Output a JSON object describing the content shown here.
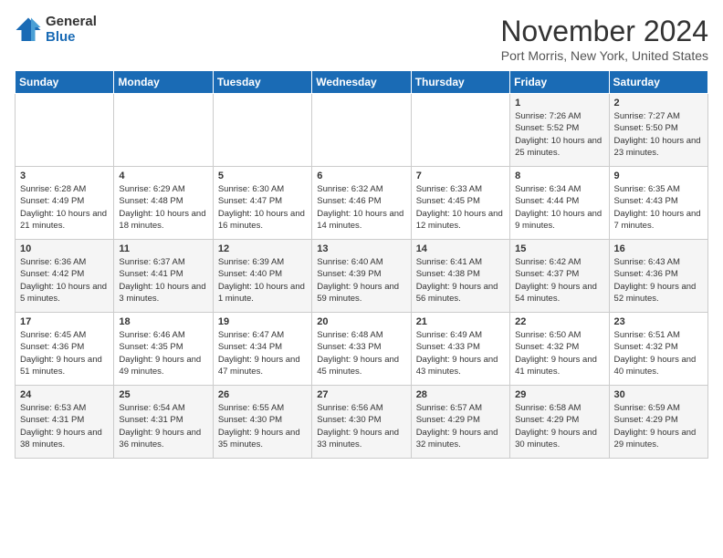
{
  "logo": {
    "general": "General",
    "blue": "Blue"
  },
  "title": "November 2024",
  "location": "Port Morris, New York, United States",
  "headers": [
    "Sunday",
    "Monday",
    "Tuesday",
    "Wednesday",
    "Thursday",
    "Friday",
    "Saturday"
  ],
  "weeks": [
    [
      {
        "day": "",
        "info": ""
      },
      {
        "day": "",
        "info": ""
      },
      {
        "day": "",
        "info": ""
      },
      {
        "day": "",
        "info": ""
      },
      {
        "day": "",
        "info": ""
      },
      {
        "day": "1",
        "info": "Sunrise: 7:26 AM\nSunset: 5:52 PM\nDaylight: 10 hours and 25 minutes."
      },
      {
        "day": "2",
        "info": "Sunrise: 7:27 AM\nSunset: 5:50 PM\nDaylight: 10 hours and 23 minutes."
      }
    ],
    [
      {
        "day": "3",
        "info": "Sunrise: 6:28 AM\nSunset: 4:49 PM\nDaylight: 10 hours and 21 minutes."
      },
      {
        "day": "4",
        "info": "Sunrise: 6:29 AM\nSunset: 4:48 PM\nDaylight: 10 hours and 18 minutes."
      },
      {
        "day": "5",
        "info": "Sunrise: 6:30 AM\nSunset: 4:47 PM\nDaylight: 10 hours and 16 minutes."
      },
      {
        "day": "6",
        "info": "Sunrise: 6:32 AM\nSunset: 4:46 PM\nDaylight: 10 hours and 14 minutes."
      },
      {
        "day": "7",
        "info": "Sunrise: 6:33 AM\nSunset: 4:45 PM\nDaylight: 10 hours and 12 minutes."
      },
      {
        "day": "8",
        "info": "Sunrise: 6:34 AM\nSunset: 4:44 PM\nDaylight: 10 hours and 9 minutes."
      },
      {
        "day": "9",
        "info": "Sunrise: 6:35 AM\nSunset: 4:43 PM\nDaylight: 10 hours and 7 minutes."
      }
    ],
    [
      {
        "day": "10",
        "info": "Sunrise: 6:36 AM\nSunset: 4:42 PM\nDaylight: 10 hours and 5 minutes."
      },
      {
        "day": "11",
        "info": "Sunrise: 6:37 AM\nSunset: 4:41 PM\nDaylight: 10 hours and 3 minutes."
      },
      {
        "day": "12",
        "info": "Sunrise: 6:39 AM\nSunset: 4:40 PM\nDaylight: 10 hours and 1 minute."
      },
      {
        "day": "13",
        "info": "Sunrise: 6:40 AM\nSunset: 4:39 PM\nDaylight: 9 hours and 59 minutes."
      },
      {
        "day": "14",
        "info": "Sunrise: 6:41 AM\nSunset: 4:38 PM\nDaylight: 9 hours and 56 minutes."
      },
      {
        "day": "15",
        "info": "Sunrise: 6:42 AM\nSunset: 4:37 PM\nDaylight: 9 hours and 54 minutes."
      },
      {
        "day": "16",
        "info": "Sunrise: 6:43 AM\nSunset: 4:36 PM\nDaylight: 9 hours and 52 minutes."
      }
    ],
    [
      {
        "day": "17",
        "info": "Sunrise: 6:45 AM\nSunset: 4:36 PM\nDaylight: 9 hours and 51 minutes."
      },
      {
        "day": "18",
        "info": "Sunrise: 6:46 AM\nSunset: 4:35 PM\nDaylight: 9 hours and 49 minutes."
      },
      {
        "day": "19",
        "info": "Sunrise: 6:47 AM\nSunset: 4:34 PM\nDaylight: 9 hours and 47 minutes."
      },
      {
        "day": "20",
        "info": "Sunrise: 6:48 AM\nSunset: 4:33 PM\nDaylight: 9 hours and 45 minutes."
      },
      {
        "day": "21",
        "info": "Sunrise: 6:49 AM\nSunset: 4:33 PM\nDaylight: 9 hours and 43 minutes."
      },
      {
        "day": "22",
        "info": "Sunrise: 6:50 AM\nSunset: 4:32 PM\nDaylight: 9 hours and 41 minutes."
      },
      {
        "day": "23",
        "info": "Sunrise: 6:51 AM\nSunset: 4:32 PM\nDaylight: 9 hours and 40 minutes."
      }
    ],
    [
      {
        "day": "24",
        "info": "Sunrise: 6:53 AM\nSunset: 4:31 PM\nDaylight: 9 hours and 38 minutes."
      },
      {
        "day": "25",
        "info": "Sunrise: 6:54 AM\nSunset: 4:31 PM\nDaylight: 9 hours and 36 minutes."
      },
      {
        "day": "26",
        "info": "Sunrise: 6:55 AM\nSunset: 4:30 PM\nDaylight: 9 hours and 35 minutes."
      },
      {
        "day": "27",
        "info": "Sunrise: 6:56 AM\nSunset: 4:30 PM\nDaylight: 9 hours and 33 minutes."
      },
      {
        "day": "28",
        "info": "Sunrise: 6:57 AM\nSunset: 4:29 PM\nDaylight: 9 hours and 32 minutes."
      },
      {
        "day": "29",
        "info": "Sunrise: 6:58 AM\nSunset: 4:29 PM\nDaylight: 9 hours and 30 minutes."
      },
      {
        "day": "30",
        "info": "Sunrise: 6:59 AM\nSunset: 4:29 PM\nDaylight: 9 hours and 29 minutes."
      }
    ]
  ]
}
